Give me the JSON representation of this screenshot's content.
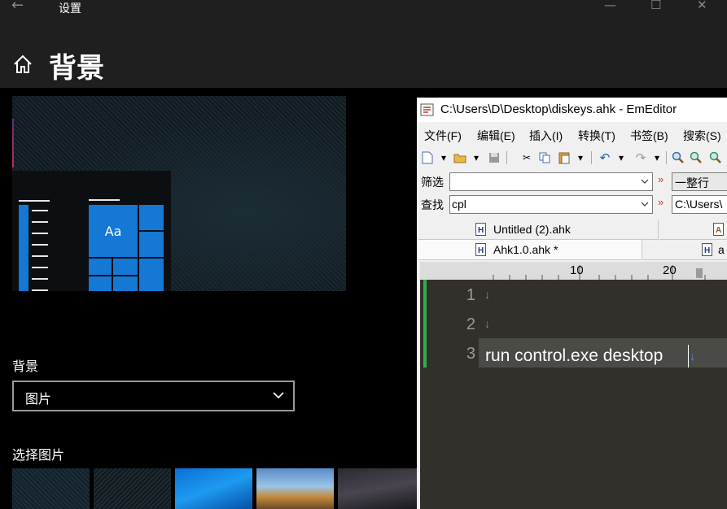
{
  "settings": {
    "window_title": "设置",
    "page_title": "背景",
    "background_label": "背景",
    "background_select": "图片",
    "choose_picture_label": "选择图片",
    "preview_tile_text": "Aa",
    "accent_color": "#1478d4"
  },
  "emeditor": {
    "title": "C:\\Users\\D\\Desktop\\diskeys.ahk - EmEditor",
    "menu": [
      "文件(F)",
      "编辑(E)",
      "插入(I)",
      "转换(T)",
      "书签(B)",
      "搜索(S)"
    ],
    "filter": {
      "label": "筛选",
      "value": "",
      "option": "一整行"
    },
    "find": {
      "label": "查找",
      "value": "cpl",
      "path": "C:\\Users\\"
    },
    "tabs_row1": [
      "Untitled (2).ahk",
      ""
    ],
    "tabs_row2": [
      "Ahk1.0.ahk *",
      "a"
    ],
    "ruler_marks": [
      "10",
      "20"
    ],
    "line_numbers": [
      "1",
      "2",
      "3"
    ],
    "code_line3": "run control.exe desktop",
    "newline_mark": "↓",
    "theme": {
      "editor_bg": "#33302c",
      "changebar": "#2db04a",
      "newline_color": "#4c8fe0"
    }
  }
}
